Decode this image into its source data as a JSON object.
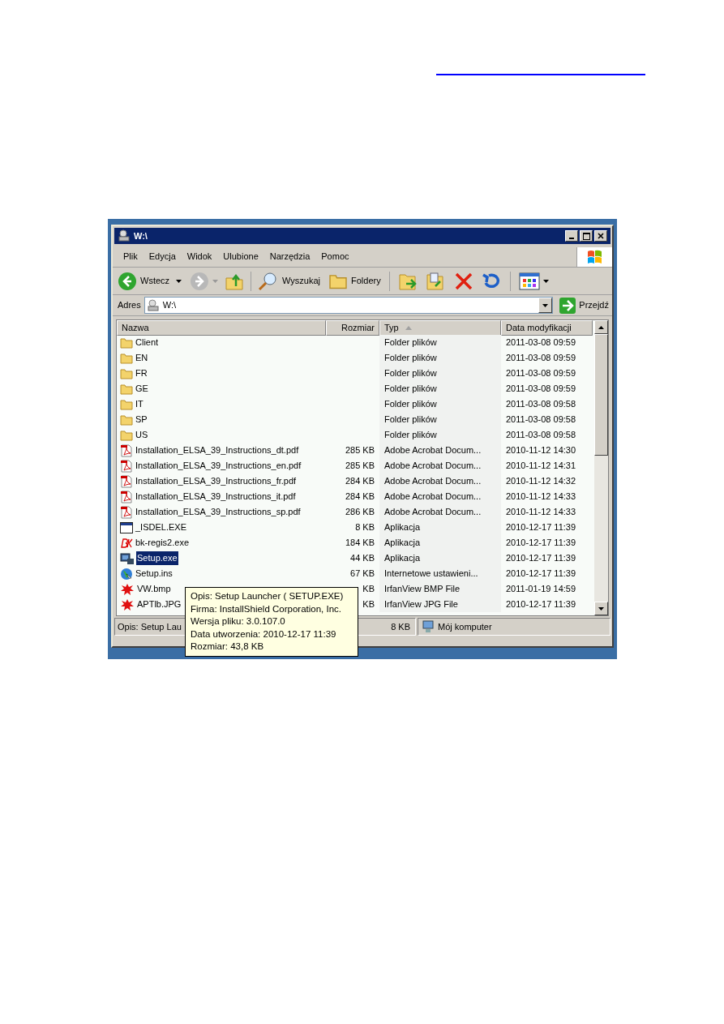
{
  "window": {
    "title": "W:\\"
  },
  "menu": [
    "Plik",
    "Edycja",
    "Widok",
    "Ulubione",
    "Narzędzia",
    "Pomoc"
  ],
  "toolbar": {
    "back": "Wstecz",
    "search": "Wyszukaj",
    "folders": "Foldery"
  },
  "address": {
    "label": "Adres",
    "value": "W:\\",
    "go": "Przejdź"
  },
  "columns": [
    {
      "label": "Nazwa",
      "sorted": false
    },
    {
      "label": "Rozmiar",
      "sorted": false
    },
    {
      "label": "Typ",
      "sorted": true
    },
    {
      "label": "Data modyfikacji",
      "sorted": false
    }
  ],
  "rows": [
    {
      "kind": "folder",
      "name": "Client",
      "size": "",
      "type": "Folder plików",
      "date": "2011-03-08 09:59",
      "selected": false
    },
    {
      "kind": "folder",
      "name": "EN",
      "size": "",
      "type": "Folder plików",
      "date": "2011-03-08 09:59",
      "selected": false
    },
    {
      "kind": "folder",
      "name": "FR",
      "size": "",
      "type": "Folder plików",
      "date": "2011-03-08 09:59",
      "selected": false
    },
    {
      "kind": "folder",
      "name": "GE",
      "size": "",
      "type": "Folder plików",
      "date": "2011-03-08 09:59",
      "selected": false
    },
    {
      "kind": "folder",
      "name": "IT",
      "size": "",
      "type": "Folder plików",
      "date": "2011-03-08 09:58",
      "selected": false
    },
    {
      "kind": "folder",
      "name": "SP",
      "size": "",
      "type": "Folder plików",
      "date": "2011-03-08 09:58",
      "selected": false
    },
    {
      "kind": "folder",
      "name": "US",
      "size": "",
      "type": "Folder plików",
      "date": "2011-03-08 09:58",
      "selected": false
    },
    {
      "kind": "pdf",
      "name": "Installation_ELSA_39_Instructions_dt.pdf",
      "size": "285 KB",
      "type": "Adobe Acrobat Docum...",
      "date": "2010-11-12 14:30",
      "selected": false
    },
    {
      "kind": "pdf",
      "name": "Installation_ELSA_39_Instructions_en.pdf",
      "size": "285 KB",
      "type": "Adobe Acrobat Docum...",
      "date": "2010-11-12 14:31",
      "selected": false
    },
    {
      "kind": "pdf",
      "name": "Installation_ELSA_39_Instructions_fr.pdf",
      "size": "284 KB",
      "type": "Adobe Acrobat Docum...",
      "date": "2010-11-12 14:32",
      "selected": false
    },
    {
      "kind": "pdf",
      "name": "Installation_ELSA_39_Instructions_it.pdf",
      "size": "284 KB",
      "type": "Adobe Acrobat Docum...",
      "date": "2010-11-12 14:33",
      "selected": false
    },
    {
      "kind": "pdf",
      "name": "Installation_ELSA_39_Instructions_sp.pdf",
      "size": "286 KB",
      "type": "Adobe Acrobat Docum...",
      "date": "2010-11-12 14:33",
      "selected": false
    },
    {
      "kind": "app",
      "name": "_ISDEL.EXE",
      "size": "8 KB",
      "type": "Aplikacja",
      "date": "2010-12-17 11:39",
      "selected": false
    },
    {
      "kind": "bk",
      "name": "bk-regis2.exe",
      "size": "184 KB",
      "type": "Aplikacja",
      "date": "2010-12-17 11:39",
      "selected": false
    },
    {
      "kind": "setup",
      "name": "Setup.exe",
      "size": "44 KB",
      "type": "Aplikacja",
      "date": "2010-12-17 11:39",
      "selected": true
    },
    {
      "kind": "globe",
      "name": "Setup.ins",
      "size": "67 KB",
      "type": "Internetowe ustawieni...",
      "date": "2010-12-17 11:39",
      "selected": false
    },
    {
      "kind": "image",
      "name": "VW.bmp",
      "size": "KB",
      "type": "IrfanView BMP File",
      "date": "2011-01-19 14:59",
      "selected": false
    },
    {
      "kind": "image",
      "name": "APTlb.JPG",
      "size": "KB",
      "type": "IrfanView JPG File",
      "date": "2010-12-17 11:39",
      "selected": false
    }
  ],
  "status_bar": {
    "description": "Opis: Setup Lau",
    "size": "8 KB",
    "location": "Mój komputer"
  },
  "tooltip": [
    "Opis: Setup Launcher ( SETUP.EXE)",
    "Firma: InstallShield Corporation, Inc.",
    "Wersja pliku: 3.0.107.0",
    "Data utworzenia: 2010-12-17 11:39",
    "Rozmiar: 43,8 KB"
  ]
}
